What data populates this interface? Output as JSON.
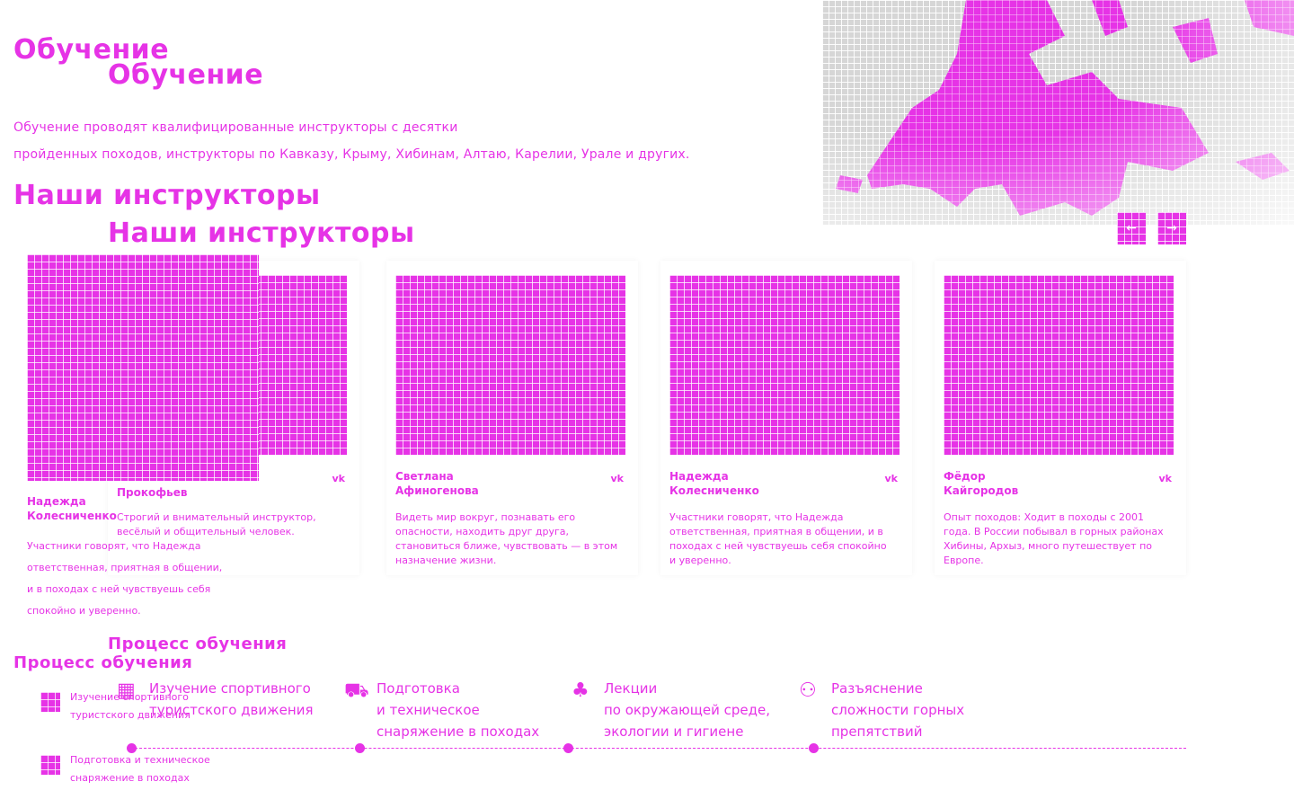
{
  "page": {
    "title": "Обучение",
    "lead_lines": [
      "Обучение проводят квалифицированные инструкторы с десятки",
      "пройденных походов, инструкторы по Кавказу, Крыму, Хибинам, Алтаю, Карелии, Урале и других."
    ]
  },
  "instructors": {
    "heading": "Наши инструкторы",
    "nav": {
      "prev": "←",
      "next": "→"
    },
    "cards": [
      {
        "name": "Прокофьев",
        "vk": "vk",
        "bio": "Строгий и внимательный инструктор, весёлый и общительный человек."
      },
      {
        "name": "Светлана\nАфиногенова",
        "vk": "vk",
        "bio": "Видеть мир вокруг, познавать его опасности, находить друг друга, становиться ближе, чувствовать — в этом назначение жизни."
      },
      {
        "name": "Надежда\nКолесниченко",
        "vk": "vk",
        "bio": "Участники говорят, что Надежда ответственная, приятная в общении, и в походах с ней чувствуешь себя спокойно и уверенно."
      },
      {
        "name": "Фёдор\nКайгородов",
        "vk": "vk",
        "bio": "Опыт походов: Ходит в походы с 2001 года. В России побывал в горных районах Хибины, Архыз, много путешествует по Европе."
      }
    ],
    "overflow_card": {
      "name": "Надежда\nКолесниченко",
      "bio_lines": [
        "Участники говорят, что Надежда",
        "ответственная, приятная в общении,",
        "и в походах с ней чувствуешь себя",
        "спокойно и уверенно."
      ]
    }
  },
  "process": {
    "heading": "Процесс обучения",
    "steps": [
      {
        "icon": "map-icon",
        "text": "Изучение спортивного\nтуристского движения"
      },
      {
        "icon": "boot-icon",
        "text": "Подготовка\nи техническое\nснаряжение в походах"
      },
      {
        "icon": "tree-icon",
        "text": "Лекции\nпо окружающей среде,\nэкологии и гигиене"
      },
      {
        "icon": "people-icon",
        "text": "Разъяснение\nсложности горных\nпрепятствий"
      }
    ],
    "mini_steps": [
      "Изучение спортивного\nтуристского движения",
      "Подготовка и техническое\nснаряжение в походах"
    ]
  },
  "colors": {
    "accent": "#e633e6",
    "map_land": "#d6d6d6"
  }
}
